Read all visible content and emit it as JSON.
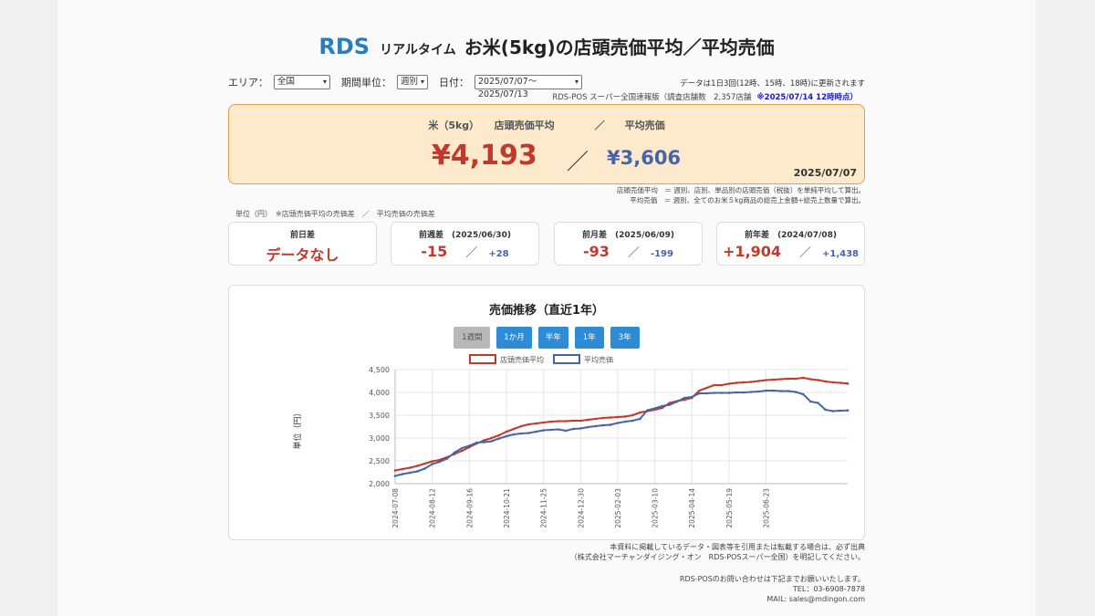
{
  "header": {
    "brand": "RDS",
    "realtime": "リアルタイム",
    "title": "お米(5kg)の店頭売価平均／平均売価"
  },
  "controls": {
    "area_label": "エリア：",
    "area_value": "全国",
    "period_label": "期間単位：",
    "period_value": "週別",
    "date_label": "日付：",
    "date_value": "2025/07/07〜2025/07/13"
  },
  "update_note": "データは1日3回(12時、15時、18時)に更新されます",
  "survey": {
    "text": "RDS-POS スーパー全国速報版（調査店舗数　2,357店舗",
    "timestamp": "※2025/07/14 12時時点）"
  },
  "main": {
    "label": "米（5kg）　　店頭売価平均　　　　／　　平均売価",
    "avg_shelf_price": "¥4,193",
    "slash": "／",
    "avg_price": "¥3,606",
    "date": "2025/07/07"
  },
  "definitions": [
    "店頭売価平均　＝ 週別、店別、単品別の店頭売価（税抜）を単純平均して算出。",
    "平均売価　＝ 週別、全てのお米５kg商品の総売上金額÷総売上数量で算出。"
  ],
  "unit_note": "単位（円）　※店頭売価平均の売価差　／　平均売価の売価差",
  "cards": [
    {
      "title": "前日差",
      "a": "データなし",
      "s": "",
      "b": ""
    },
    {
      "title": "前週差　(2025/06/30)",
      "a": "-15",
      "s": "／",
      "b": "+28"
    },
    {
      "title": "前月差　(2025/06/09)",
      "a": "-93",
      "s": "／",
      "b": "-199"
    },
    {
      "title": "前年差　(2024/07/08)",
      "a": "+1,904",
      "s": "／",
      "b": "+1,438"
    }
  ],
  "range_buttons": [
    "1週間",
    "1か月",
    "半年",
    "1年",
    "3年"
  ],
  "footer": {
    "line1": "本資料に掲載しているデータ・図表等を引用または転載する場合は、必ず出典",
    "line2": "（株式会社マーチャンダイジング・オン　RDS-POSスーパー全国）を明記してください。",
    "contact1": "RDS-POSのお問い合わせは下記までお願いいたします。",
    "contact2": "TEL：03-6908-7878",
    "contact3": "MAIL: sales@mdingon.com"
  },
  "colors": {
    "shelf": "#c0392b",
    "avg": "#4665a8",
    "accent": "#2e8bd6"
  },
  "chart_data": {
    "type": "line",
    "title": "売価推移（直近1年）",
    "ylabel": "単位（円）",
    "ylim": [
      2000,
      4500
    ],
    "yticks": [
      "2,000",
      "2,500",
      "3,000",
      "3,500",
      "4,000",
      "4,500"
    ],
    "xtick_labels": [
      "2024-07-08",
      "2024-08-12",
      "2024-09-16",
      "2024-10-21",
      "2024-11-25",
      "2024-12-30",
      "2025-02-03",
      "2025-03-10",
      "2025-04-14",
      "2025-05-19",
      "2025-06-23"
    ],
    "legend_position": "top",
    "grid": true,
    "series": [
      {
        "name": "店頭売価平均",
        "color": "#c0392b",
        "values": [
          2290,
          2320,
          2350,
          2390,
          2440,
          2490,
          2520,
          2580,
          2650,
          2720,
          2800,
          2880,
          2950,
          3000,
          3060,
          3140,
          3200,
          3260,
          3300,
          3320,
          3340,
          3360,
          3370,
          3370,
          3380,
          3380,
          3400,
          3420,
          3440,
          3450,
          3460,
          3470,
          3500,
          3560,
          3590,
          3620,
          3660,
          3770,
          3810,
          3840,
          3880,
          4040,
          4100,
          4160,
          4160,
          4190,
          4210,
          4220,
          4230,
          4250,
          4270,
          4280,
          4290,
          4300,
          4300,
          4320,
          4290,
          4270,
          4240,
          4220,
          4210,
          4193
        ]
      },
      {
        "name": "平均売価",
        "color": "#4665a8",
        "values": [
          2170,
          2210,
          2240,
          2270,
          2330,
          2430,
          2480,
          2550,
          2680,
          2780,
          2830,
          2900,
          2910,
          2930,
          2990,
          3040,
          3080,
          3100,
          3110,
          3140,
          3170,
          3180,
          3190,
          3160,
          3200,
          3210,
          3240,
          3260,
          3280,
          3290,
          3330,
          3360,
          3380,
          3420,
          3610,
          3650,
          3700,
          3730,
          3800,
          3880,
          3900,
          3980,
          3980,
          3990,
          3990,
          3990,
          4000,
          4000,
          4010,
          4020,
          4040,
          4040,
          4030,
          4030,
          4010,
          3960,
          3800,
          3770,
          3620,
          3590,
          3600,
          3606
        ]
      }
    ]
  }
}
